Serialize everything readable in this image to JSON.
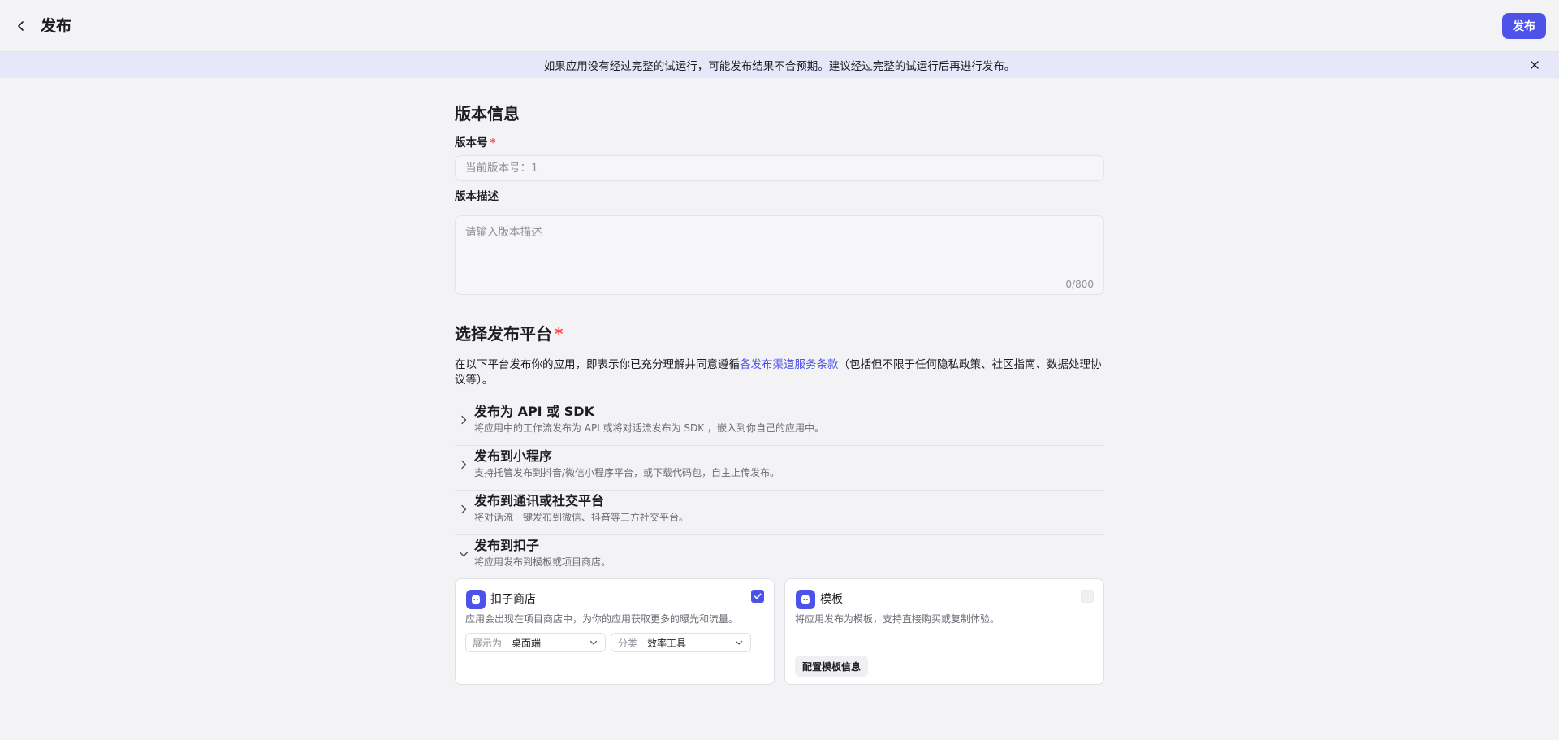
{
  "header": {
    "back_icon": "chevron-left-icon",
    "title": "发布",
    "publish_label": "发布"
  },
  "notice": {
    "text": "如果应用没有经过完整的试运行，可能发布结果不合预期。建议经过完整的试运行后再进行发布。",
    "close_icon": "close-icon"
  },
  "version_info": {
    "section_title": "版本信息",
    "version_label": "版本号",
    "version_required": "*",
    "version_placeholder": "当前版本号：1",
    "desc_label": "版本描述",
    "desc_placeholder": "请输入版本描述",
    "desc_counter": "0/800"
  },
  "platform": {
    "section_title": "选择发布平台",
    "required": "*",
    "intro_before": "在以下平台发布你的应用，即表示你已充分理解并同意遵循",
    "intro_link": "各发布渠道服务条款",
    "intro_after": "（包括但不限于任何隐私政策、社区指南、数据处理协议等）。",
    "accordions": [
      {
        "title": "发布为 API 或 SDK",
        "subtitle": "将应用中的工作流发布为 API 或将对话流发布为 SDK ，嵌入到你自己的应用中。",
        "expanded": false
      },
      {
        "title": "发布到小程序",
        "subtitle": "支持托管发布到抖音/微信小程序平台，或下载代码包，自主上传发布。",
        "expanded": false
      },
      {
        "title": "发布到通讯或社交平台",
        "subtitle": "将对话流一键发布到微信、抖音等三方社交平台。",
        "expanded": false
      },
      {
        "title": "发布到扣子",
        "subtitle": "将应用发布到模板或项目商店。",
        "expanded": true
      }
    ],
    "cards": {
      "store": {
        "icon": "coze-logo-icon",
        "title": "扣子商店",
        "description": "应用会出现在项目商店中，为你的应用获取更多的曝光和流量。",
        "checked": true,
        "display_label": "展示为",
        "display_value": "桌面端",
        "category_label": "分类",
        "category_value": "效率工具"
      },
      "template": {
        "icon": "coze-logo-icon",
        "title": "模板",
        "description": "将应用发布为模板，支持直接购买或复制体验。",
        "checked": false,
        "config_label": "配置模板信息"
      }
    }
  },
  "colors": {
    "accent": "#4d53e8",
    "required": "#f54a45",
    "notice_bg": "#e6e8fa",
    "page_bg": "#f3f3f5"
  }
}
